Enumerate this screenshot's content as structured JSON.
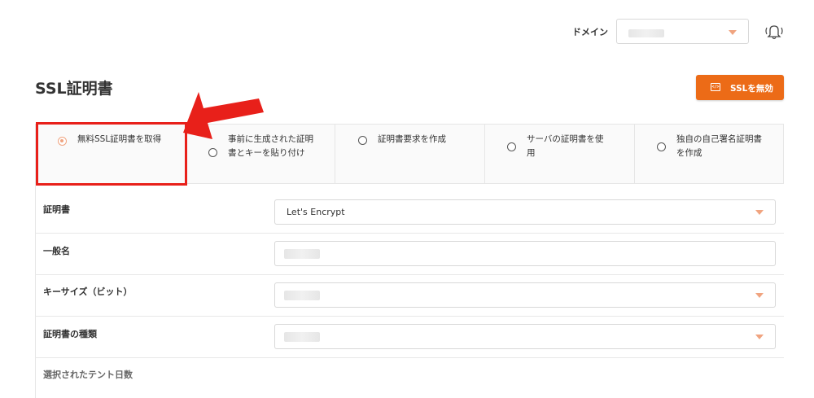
{
  "header": {
    "domain_label": "ドメイン",
    "bell_icon": "bell-icon"
  },
  "page": {
    "title": "SSL証明書",
    "disable_button_label": "SSLを無効",
    "disable_button_icon": "code-icon"
  },
  "options": [
    {
      "label": "無料SSL証明書を取得",
      "selected": true
    },
    {
      "label": "事前に生成された証明書とキーを貼り付け",
      "selected": false
    },
    {
      "label": "証明書要求を作成",
      "selected": false
    },
    {
      "label": "サーバの証明書を使用",
      "selected": false
    },
    {
      "label": "独自の自己署名証明書を作成",
      "selected": false
    }
  ],
  "form": {
    "certificate": {
      "label": "証明書",
      "value": "Let's Encrypt"
    },
    "common_name": {
      "label": "一般名"
    },
    "key_size": {
      "label": "キーサイズ（ビット）"
    },
    "cert_type": {
      "label": "証明書の種類"
    },
    "partial_label": "選択されたテント日数"
  },
  "colors": {
    "accent": "#ec6b17",
    "accent_soft": "#f0a480",
    "annotation": "#e8201a"
  }
}
